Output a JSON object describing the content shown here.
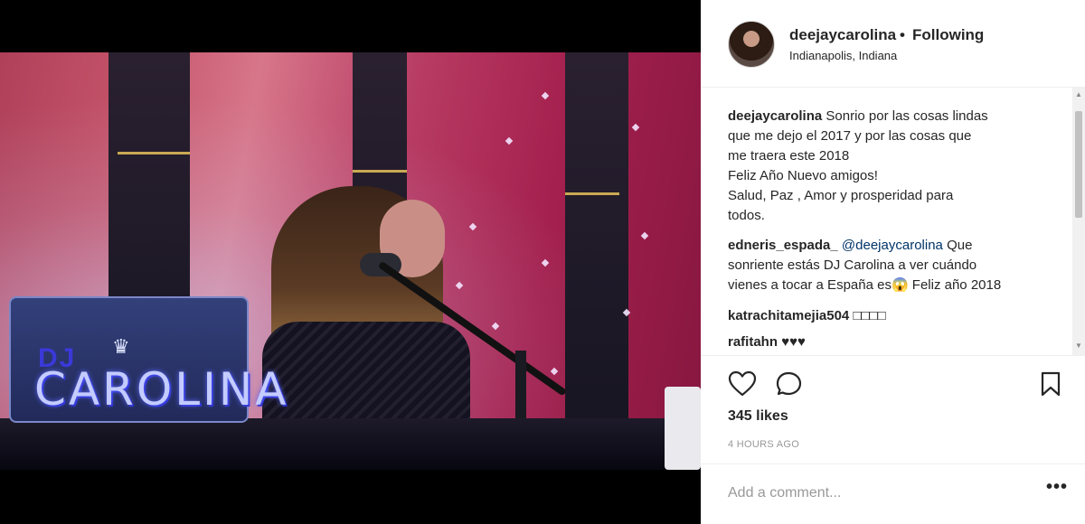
{
  "post": {
    "username": "deejaycarolina",
    "follow_status": "Following",
    "separator": "•",
    "location": "Indianapolis, Indiana"
  },
  "photo": {
    "laptop_text_dj": "DJ",
    "laptop_text_name": "CAROLINA",
    "crown_icon": "crown-icon"
  },
  "caption": {
    "user": "deejaycarolina",
    "lines": [
      "Sonrio por las cosas lindas",
      "que me dejo el 2017 y por las cosas que",
      "me traera este 2018",
      "Feliz Año Nuevo amigos!",
      "Salud, Paz , Amor y prosperidad para",
      "todos."
    ]
  },
  "comments": [
    {
      "user": "edneris_espada_",
      "mention": "@deejaycarolina",
      "text_1": "Que",
      "line_2": "sonriente estás DJ Carolina a ver cuándo",
      "line_3": "vienes a tocar a España es😱 Feliz año 2018"
    },
    {
      "user": "katrachitamejia504",
      "text": "□□□□"
    },
    {
      "user": "rafitahn",
      "text": "♥♥♥"
    }
  ],
  "actions": {
    "like_icon": "heart-icon",
    "comment_icon": "comment-icon",
    "save_icon": "bookmark-icon",
    "likes": "345 likes",
    "time": "4 HOURS AGO"
  },
  "add_comment": {
    "placeholder": "Add a comment...",
    "more_label": "•••"
  },
  "colors": {
    "text": "#262626",
    "muted": "#999999",
    "mention": "#003569",
    "divider": "#efefef"
  }
}
